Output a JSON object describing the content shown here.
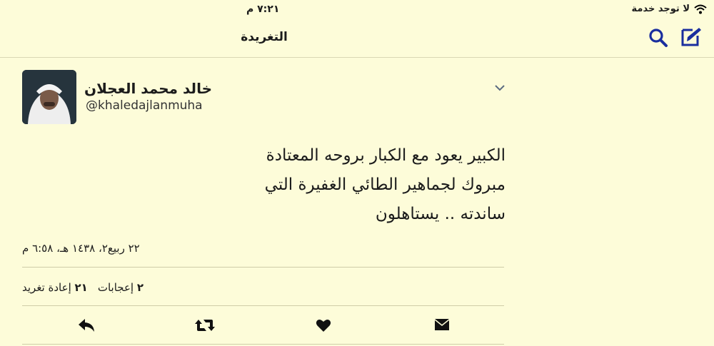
{
  "status_bar": {
    "time": "٧:٢١ م",
    "carrier": "لا توجد خدمة"
  },
  "nav": {
    "title": "التغريدة"
  },
  "tweet": {
    "author_name": "خالد محمد العجلان",
    "author_handle": "@khaledajlanmuha",
    "text_lines": [
      "الكبير يعود مع الكبار بروحه المعتادة",
      "مبروك لجماهير الطائي الغفيرة التي",
      "ساندته .. يستاهلون"
    ],
    "timestamp": "٢٢ ربيع٢، ١٤٣٨ هـ، ٦:٥٨ م",
    "likes_count": "٢",
    "likes_label": "إعجابات",
    "retweets_count": "٢١",
    "retweets_label": "إعادة تغريد"
  },
  "icons": {
    "nav": [
      "compose-icon",
      "search-icon"
    ],
    "actions": [
      "reply-icon",
      "retweet-icon",
      "heart-icon",
      "envelope-icon"
    ]
  },
  "colors": {
    "accent": "#1a2e9e",
    "background": "#fdfcd9"
  }
}
